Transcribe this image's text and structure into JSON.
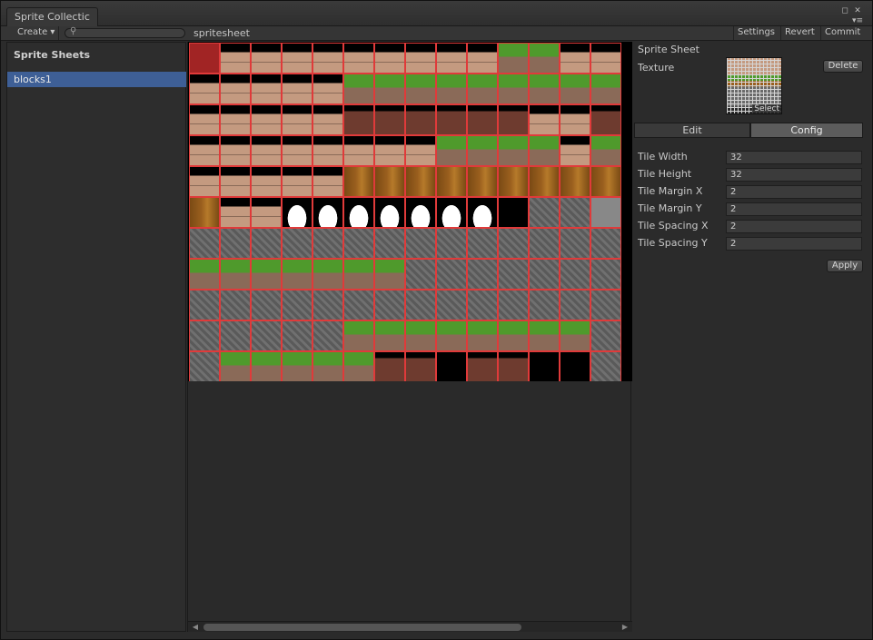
{
  "window": {
    "tab_title": "Sprite Collectic",
    "menu_icon": "window-menu-icon"
  },
  "toolbar": {
    "create_label": "Create ▾",
    "search_placeholder": "",
    "path": "spritesheet",
    "settings_label": "Settings",
    "revert_label": "Revert",
    "commit_label": "Commit"
  },
  "left_panel": {
    "title": "Sprite Sheets",
    "items": [
      {
        "label": "blocks1",
        "selected": true
      }
    ]
  },
  "sheet_view": {
    "columns": 14,
    "rows": 11,
    "grid_color": "#e03a3a"
  },
  "inspector": {
    "header": "Sprite Sheet",
    "texture_label": "Texture",
    "select_label": "Select",
    "delete_label": "Delete",
    "tabs": [
      {
        "label": "Edit",
        "active": false
      },
      {
        "label": "Config",
        "active": true
      }
    ],
    "fields": [
      {
        "label": "Tile Width",
        "value": "32"
      },
      {
        "label": "Tile Height",
        "value": "32"
      },
      {
        "label": "Tile Margin X",
        "value": "2"
      },
      {
        "label": "Tile Margin Y",
        "value": "2"
      },
      {
        "label": "Tile Spacing X",
        "value": "2"
      },
      {
        "label": "Tile Spacing Y",
        "value": "2"
      }
    ],
    "apply_label": "Apply"
  },
  "colors": {
    "accent": "#3e5f96",
    "brick": "#c49a80",
    "grass": "#4f9a2c",
    "stone": "#6a6a6a",
    "wood": "#9a5f1e",
    "cloud": "#ffffff",
    "dirt": "#6e3b2f"
  }
}
